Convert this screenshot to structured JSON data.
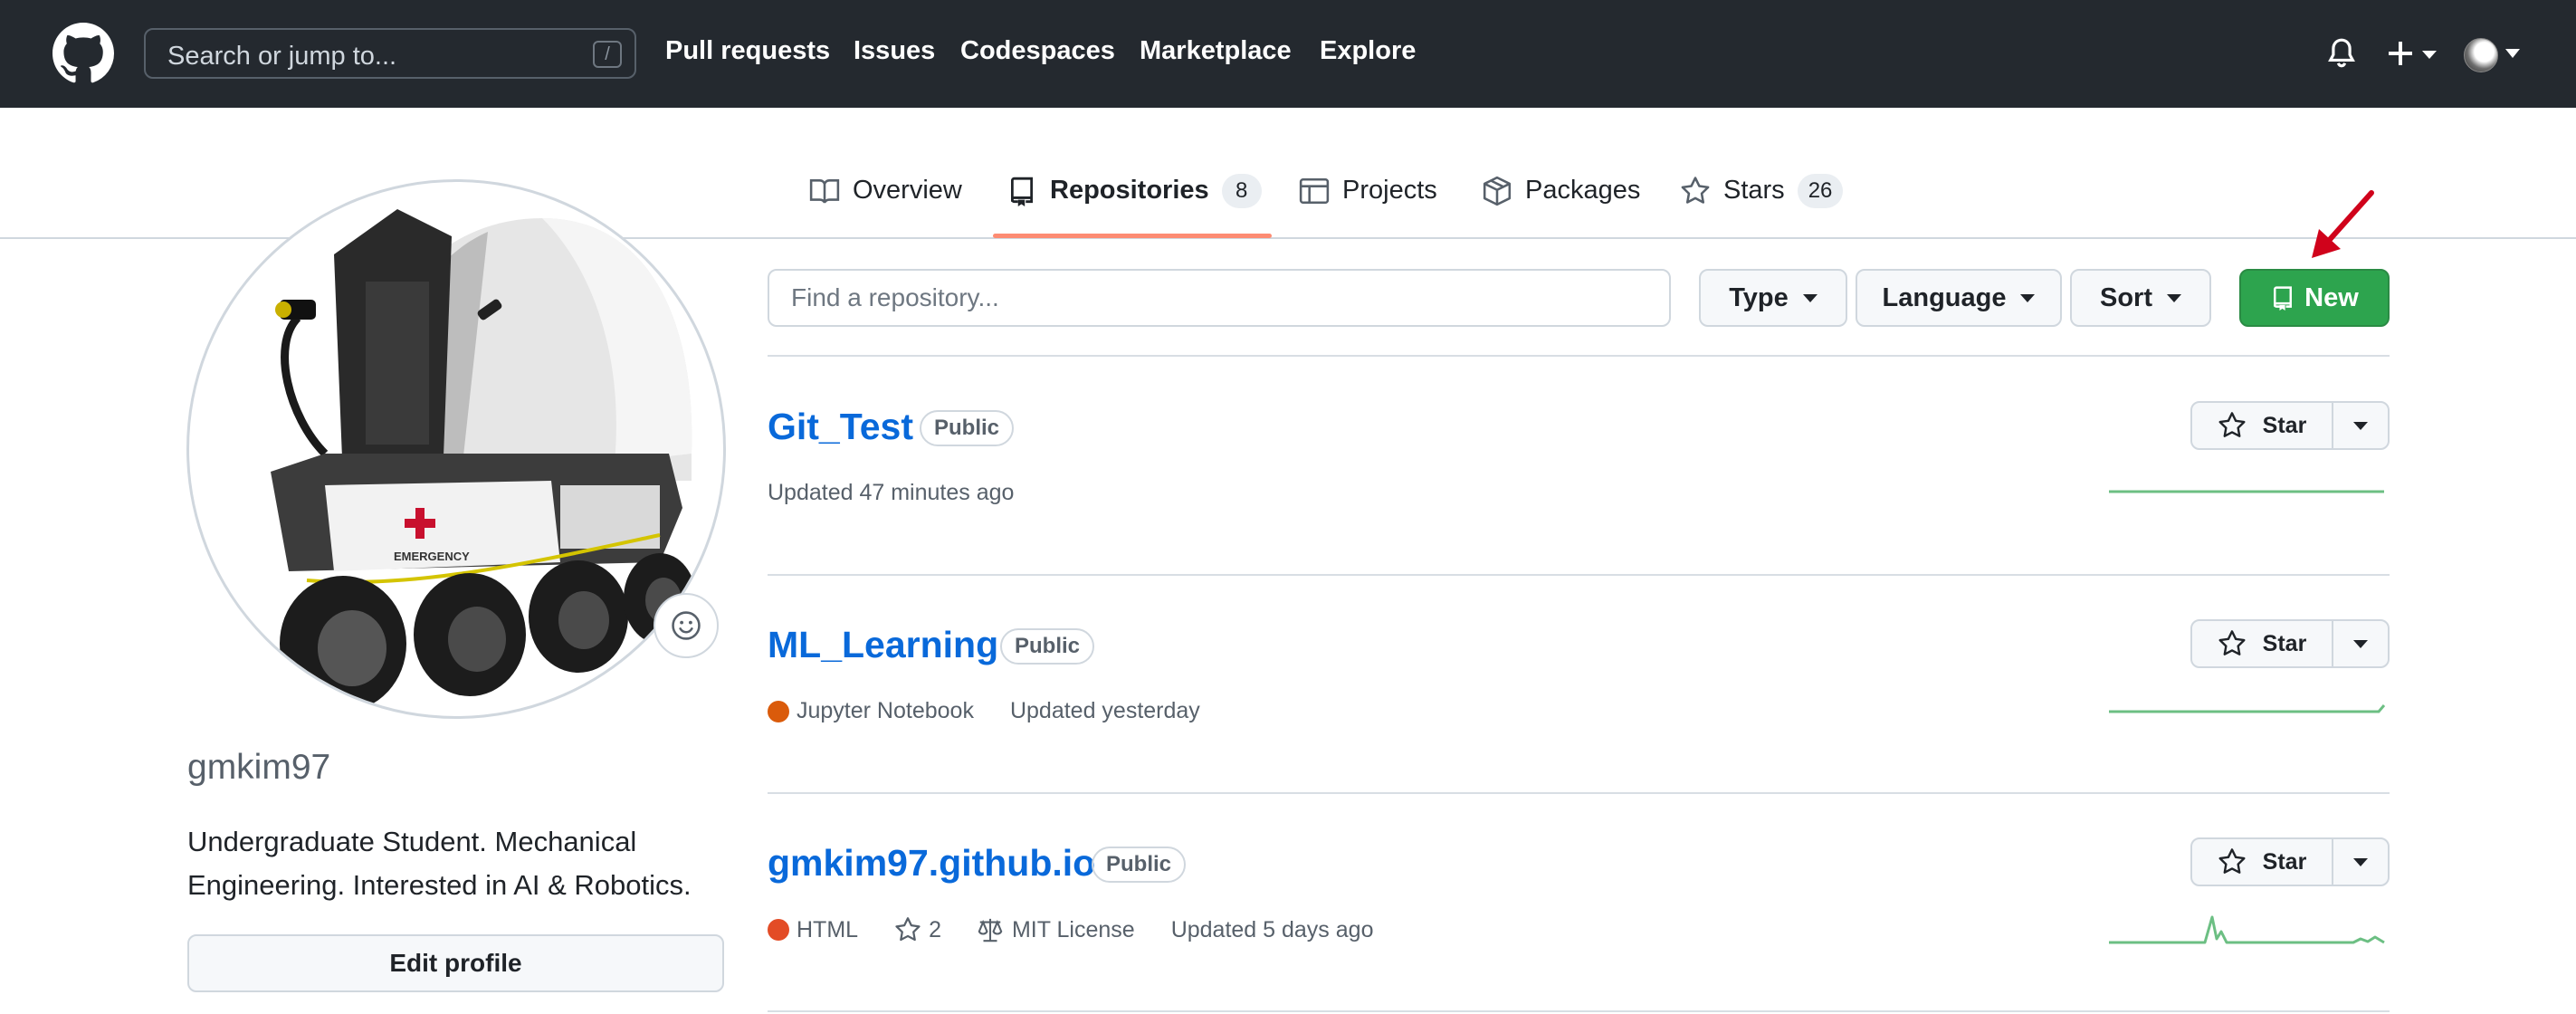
{
  "header": {
    "search_placeholder": "Search or jump to...",
    "search_shortcut": "/",
    "nav": [
      "Pull requests",
      "Issues",
      "Codespaces",
      "Marketplace",
      "Explore"
    ]
  },
  "tabs": [
    {
      "label": "Overview",
      "icon": "book-icon"
    },
    {
      "label": "Repositories",
      "icon": "repo-icon",
      "count": "8",
      "active": true
    },
    {
      "label": "Projects",
      "icon": "table-icon"
    },
    {
      "label": "Packages",
      "icon": "package-icon"
    },
    {
      "label": "Stars",
      "icon": "star-icon",
      "count": "26"
    }
  ],
  "profile": {
    "username": "gmkim97",
    "bio": "Undergraduate Student. Mechanical Engineering. Interested in AI & Robotics.",
    "edit_button": "Edit profile",
    "avatar_label": "EMERGENCY"
  },
  "toolbar": {
    "find_placeholder": "Find a repository...",
    "type_label": "Type",
    "language_label": "Language",
    "sort_label": "Sort",
    "new_label": "New"
  },
  "repos": [
    {
      "name": "Git_Test",
      "visibility": "Public",
      "updated": "Updated 47 minutes ago",
      "star_label": "Star"
    },
    {
      "name": "ML_Learning",
      "visibility": "Public",
      "language": "Jupyter Notebook",
      "language_color": "#DA5B0B",
      "updated": "Updated yesterday",
      "star_label": "Star"
    },
    {
      "name": "gmkim97.github.io",
      "visibility": "Public",
      "language": "HTML",
      "language_color": "#e34c26",
      "stars": "2",
      "license": "MIT License",
      "updated": "Updated 5 days ago",
      "star_label": "Star"
    }
  ],
  "colors": {
    "header_bg": "#24292f",
    "accent_link": "#0969da",
    "new_button": "#2da44e",
    "tab_underline": "#fd8c73",
    "annotation_arrow": "#d0021b"
  }
}
